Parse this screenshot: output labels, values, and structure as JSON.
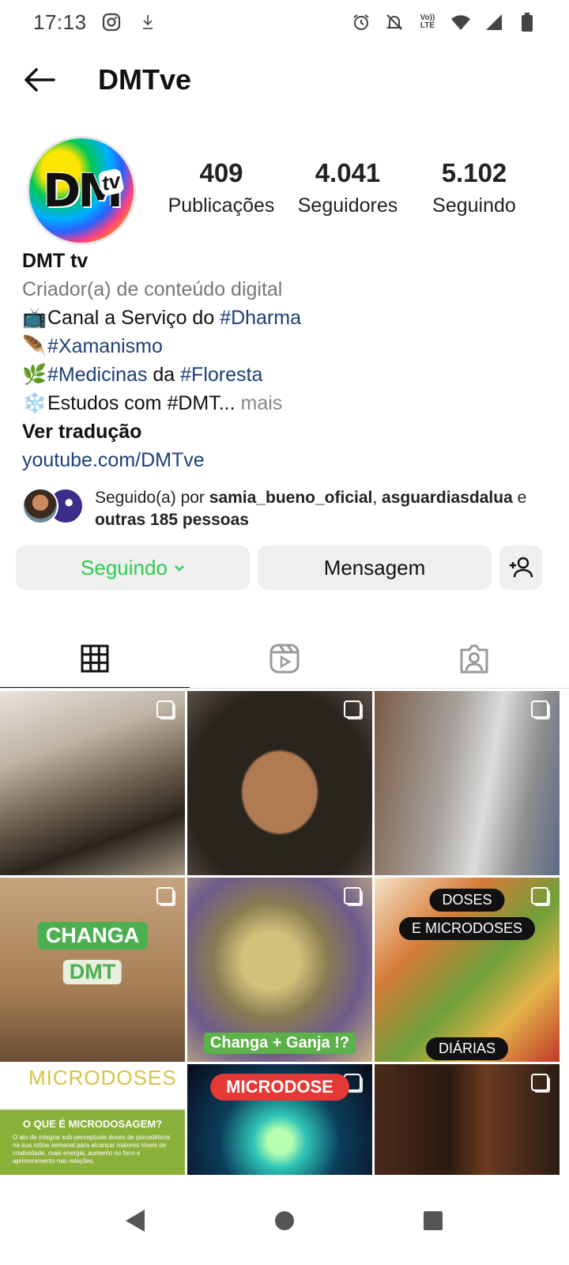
{
  "status_bar": {
    "time": "17:13",
    "network_label": "Vo)) LTE"
  },
  "header": {
    "username": "DMTve"
  },
  "profile": {
    "avatar_text": "DM",
    "avatar_tv": "tv",
    "stats": [
      {
        "value": "409",
        "label": "Publicações"
      },
      {
        "value": "4.041",
        "label": "Seguidores"
      },
      {
        "value": "5.102",
        "label": "Seguindo"
      }
    ],
    "name": "DMT tv",
    "category": "Criador(a) de conteúdo digital",
    "bio": {
      "line1_text": "Canal a Serviço do ",
      "line1_tag": "#Dharma",
      "line2_tag": "#Xamanismo",
      "line3_tag1": "#Medicinas",
      "line3_mid": " da ",
      "line3_tag2": "#Floresta",
      "line4_text": "Estudos com #DMT...",
      "line4_more": " mais",
      "emoji1": "📺",
      "emoji2": "🪶",
      "emoji3": "🌿",
      "emoji4": "❄️"
    },
    "translate": "Ver tradução",
    "link": "youtube.com/DMTve",
    "followed_by": {
      "prefix": "Seguido(a) por ",
      "user1": "samia_bueno_oficial",
      "sep": ", ",
      "user2": "asguardiasdalua",
      "mid": " e ",
      "others": "outras 185 pessoas"
    }
  },
  "actions": {
    "following": "Seguindo",
    "message": "Mensagem"
  },
  "grid": {
    "cell4_label1": "CHANGA",
    "cell4_label2": "DMT",
    "cell5_label": "Changa + Ganja !?",
    "cell6_label1": "DOSES",
    "cell6_label2": "E MICRODOSES",
    "cell6_label3": "DIÁRIAS",
    "cell7_title": "MICRODOSES",
    "cell7_sub": "O QUE É MICRODOSAGEM?",
    "cell7_desc": "O ato de integrar sub-perceptuais doses de psicodélicos na sua rotina semanal para alcançar maiores níveis de criatividade, mais energia, aumento no foco e aprimoramento nas relações.",
    "cell8_label": "MICRODOSE"
  }
}
